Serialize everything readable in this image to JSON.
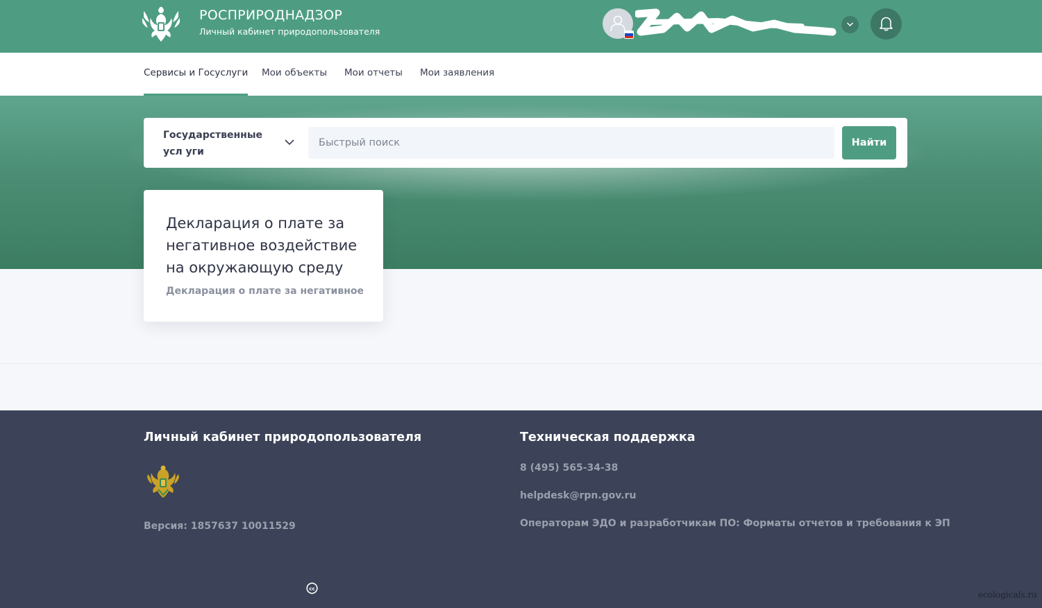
{
  "header": {
    "brand_title": "РОСПРИРОДНАДЗОР",
    "brand_subtitle": "Личный кабинет природопользователя"
  },
  "nav": {
    "items": [
      {
        "label": "Сервисы и Госуслуги",
        "active": true
      },
      {
        "label": "Мои объекты",
        "active": false
      },
      {
        "label": "Мои отчеты",
        "active": false
      },
      {
        "label": "Мои заявления",
        "active": false
      }
    ]
  },
  "search": {
    "category": "Государственные усл уги",
    "placeholder": "Быстрый поиск",
    "value": "",
    "button_label": "Найти"
  },
  "card": {
    "title": "Декларация о плате за негативное воздействие на окружающую среду",
    "description": "Декларация о плате за негативное"
  },
  "footer": {
    "left_title": "Личный кабинет природопользователя",
    "version": "Версия: 1857637 10011529",
    "right_title": "Техническая поддержка",
    "phone": "8 (495) 565-34-38",
    "email": "helpdesk@rpn.gov.ru",
    "formats_link": "Операторам ЭДО и разработчикам ПО: Форматы отчетов и требования к ЭП"
  },
  "watermark": "ecologicals.ru",
  "colors": {
    "brand_green": "#4e9d82",
    "footer_bg": "#3c4257",
    "page_bg": "#f5f7fa"
  },
  "icons": [
    "emblem-icon",
    "user-avatar-icon",
    "flag-icon",
    "chevron-down-icon",
    "bell-icon",
    "cc-icon"
  ]
}
